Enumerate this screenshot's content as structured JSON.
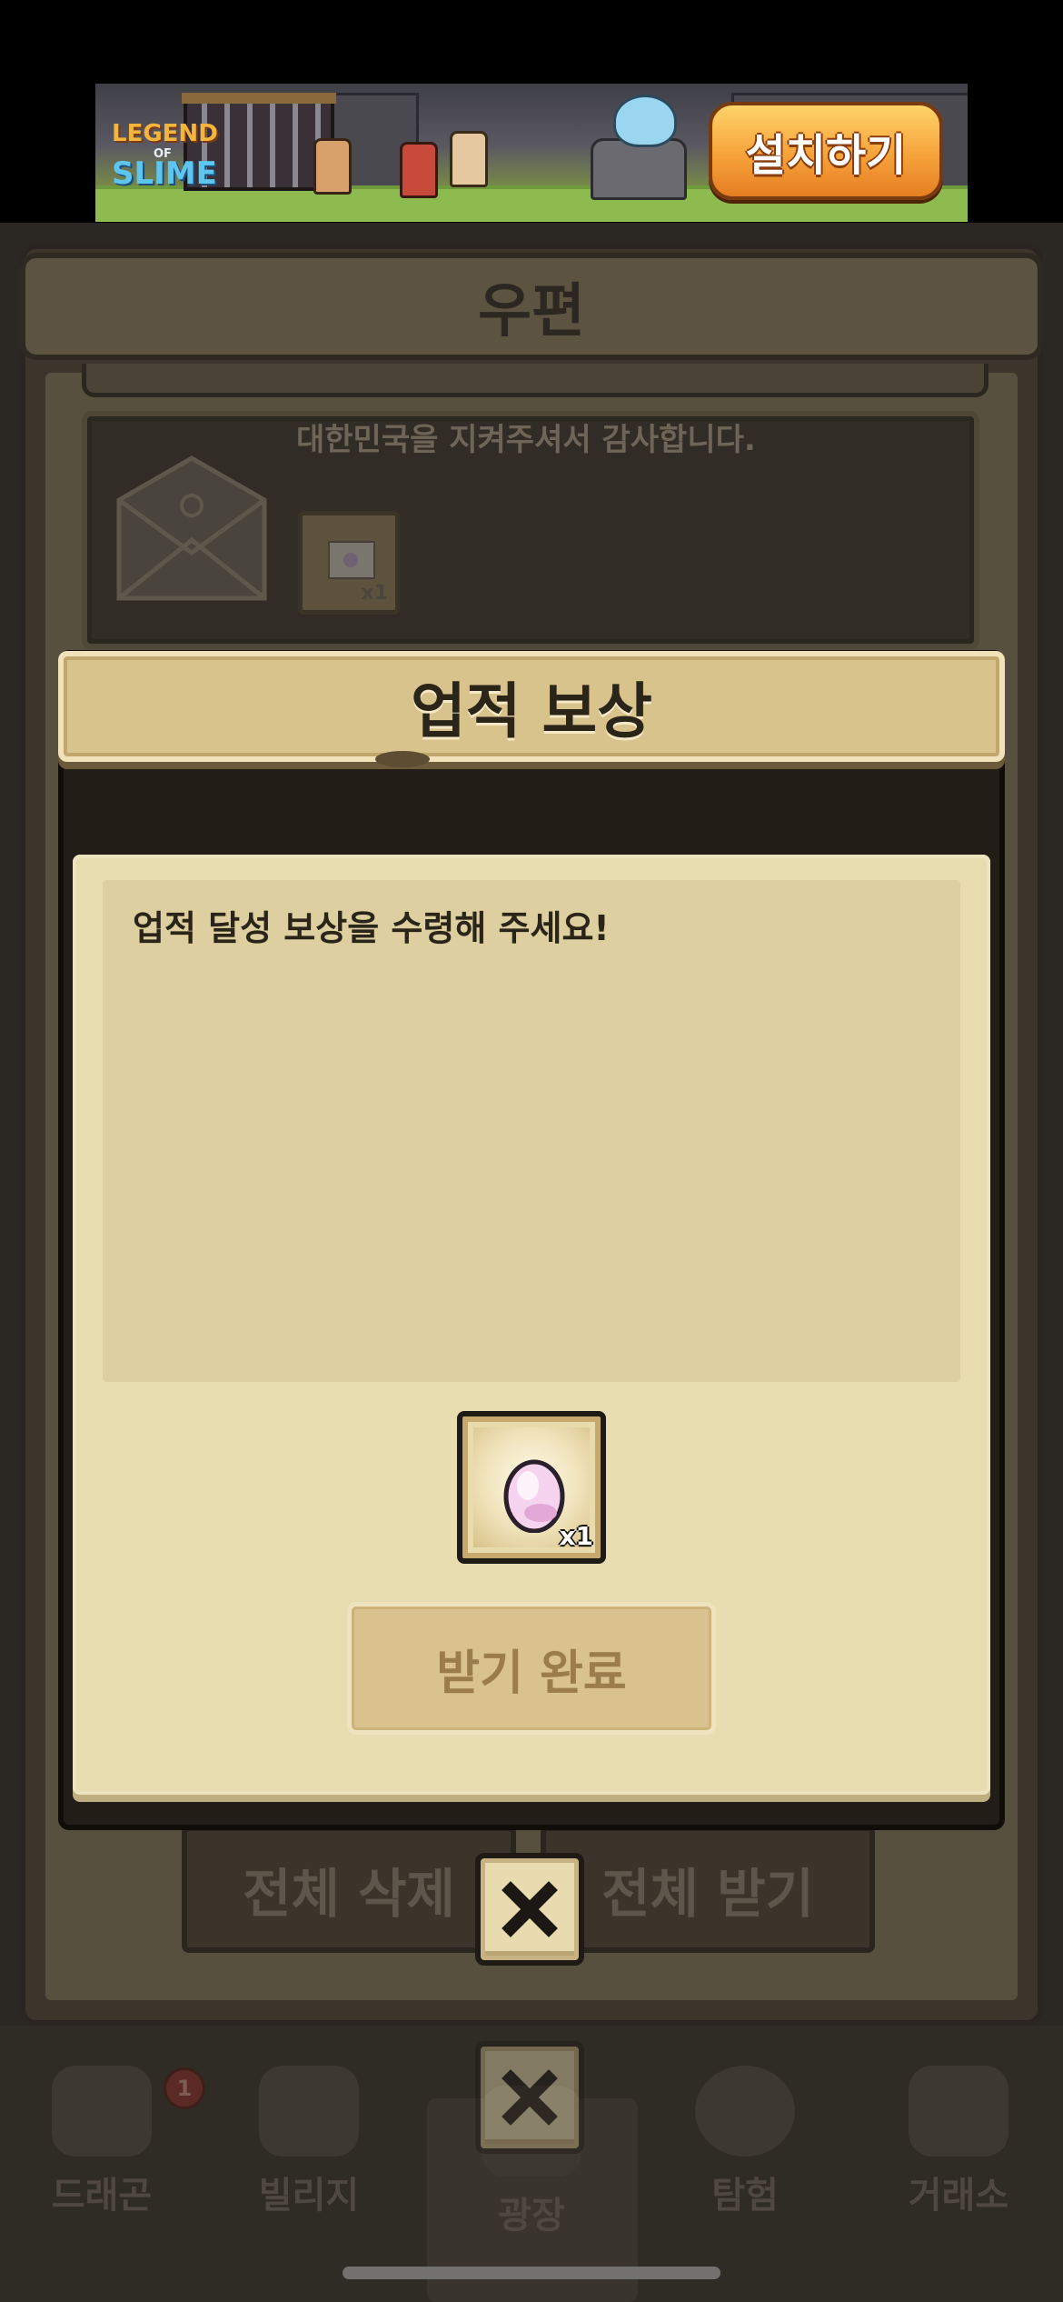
{
  "ad": {
    "logo_line1": "LEGEND",
    "logo_line2": "OF",
    "logo_line3": "SLIME",
    "install_label": "설치하기"
  },
  "mail": {
    "title": "우편",
    "item_message": "대한민국을 지켜주셔서 감사합니다.",
    "item_reward_qty": "x1",
    "delete_all_label": "전체 삭제",
    "receive_all_label": "전체 받기"
  },
  "nav": {
    "items": [
      {
        "label": "드래곤"
      },
      {
        "label": "빌리지"
      },
      {
        "label": "광장"
      },
      {
        "label": "탐험"
      },
      {
        "label": "거래소"
      }
    ],
    "badge": "1"
  },
  "reward_modal": {
    "title": "업적 보상",
    "message": "업적 달성 보상을 수령해 주세요!",
    "item_qty": "x1",
    "claimed_label": "받기 완료",
    "item_icon": "pink-egg-icon"
  },
  "colors": {
    "modal_body": "#e8ddb0",
    "modal_header": "#d9c38c",
    "dim_background": "#2b2823"
  }
}
